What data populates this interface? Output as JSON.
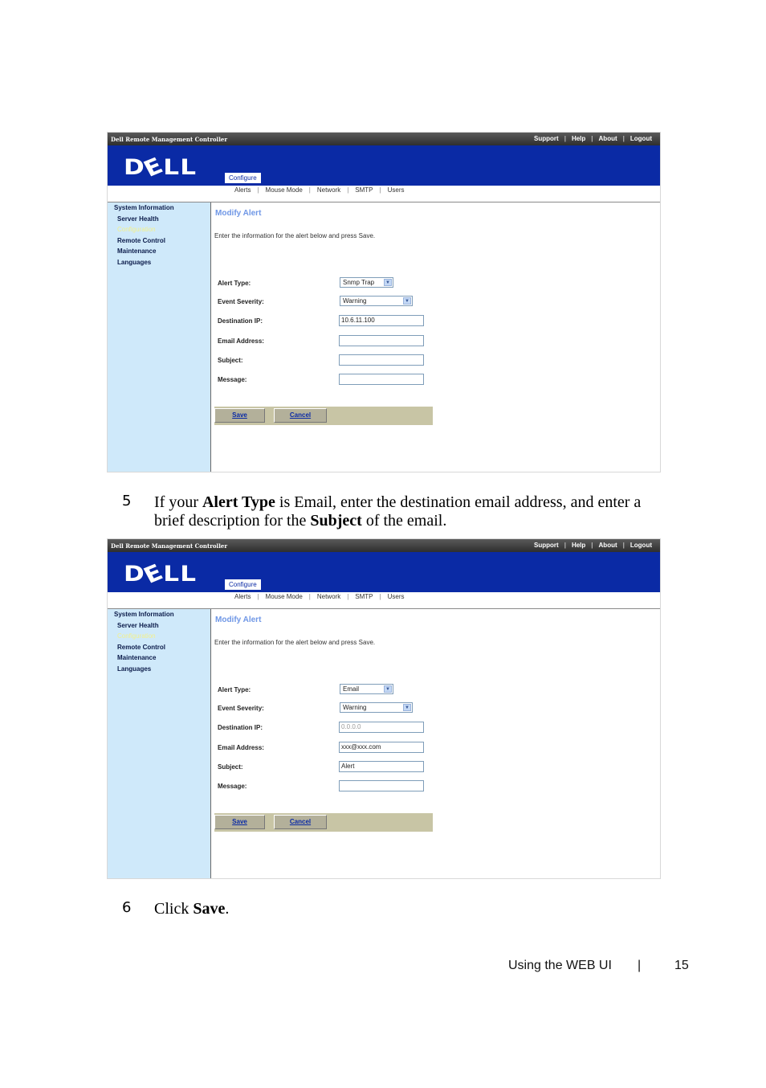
{
  "app": {
    "product_name": "Dell Remote Management Controller",
    "top_links": [
      "Support",
      "Help",
      "About",
      "Logout"
    ],
    "logo": "DELL",
    "active_tab": "Configure",
    "subnav": [
      "Alerts",
      "Mouse Mode",
      "Network",
      "SMTP",
      "Users"
    ],
    "sidebar": {
      "header": "System Information",
      "items": [
        "Server Health",
        "Configuration",
        "Remote Control",
        "Maintenance",
        "Languages"
      ],
      "active_item": "Configuration"
    },
    "page_title": "Modify Alert",
    "instruction": "Enter the information for the alert below and press Save.",
    "labels": {
      "alert_type": "Alert Type:",
      "event_severity": "Event Severity:",
      "destination_ip": "Destination IP:",
      "email_address": "Email Address:",
      "subject": "Subject:",
      "message": "Message:"
    },
    "buttons": {
      "save": "Save",
      "cancel": "Cancel"
    }
  },
  "screenshot1": {
    "alert_type": "Snmp Trap",
    "event_severity": "Warning",
    "destination_ip": "10.6.11.100",
    "email_address": "",
    "subject": "",
    "message": ""
  },
  "screenshot2": {
    "alert_type": "Email",
    "event_severity": "Warning",
    "destination_ip": "0.0.0.0",
    "email_address": "xxx@xxx.com",
    "subject": "Alert",
    "message": ""
  },
  "steps": [
    {
      "number": "5",
      "parts": [
        "If your ",
        "Alert Type",
        " is Email, enter the destination email address, and enter a brief description for the ",
        "Subject",
        " of the email."
      ]
    },
    {
      "number": "6",
      "parts": [
        "Click ",
        "Save",
        "."
      ]
    }
  ],
  "footer": {
    "section": "Using the WEB UI",
    "separator": "|",
    "page": "15"
  }
}
